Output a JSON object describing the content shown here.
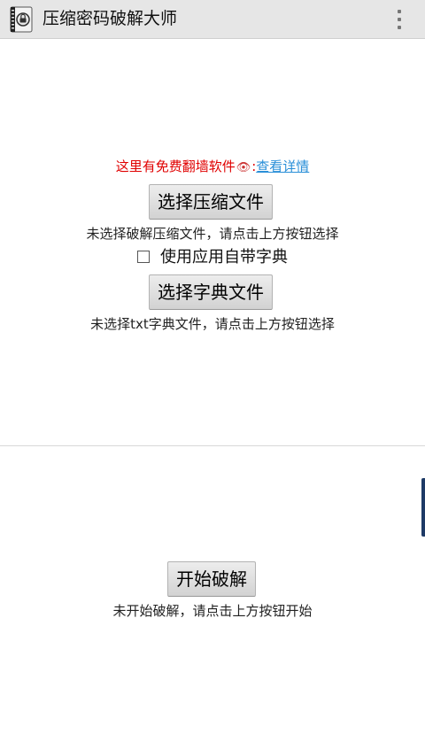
{
  "header": {
    "title": "压缩密码破解大师",
    "app_icon": "archive-app-icon",
    "menu_icon": "overflow-menu-icon"
  },
  "ad": {
    "text": "这里有免费翻墙软件",
    "eye": "👁",
    "separator": ":",
    "link_label": "查看详情"
  },
  "compress": {
    "button_label": "选择压缩文件",
    "status": "未选择破解压缩文件，请点击上方按钮选择"
  },
  "dict_option": {
    "label": "使用应用自带字典",
    "checked": false
  },
  "dictionary": {
    "button_label": "选择字典文件",
    "status": "未选择txt字典文件，请点击上方按钮选择"
  },
  "crack": {
    "button_label": "开始破解",
    "status": "未开始破解，请点击上方按钮开始"
  },
  "colors": {
    "ad_text": "#e00000",
    "link": "#2a8fd8",
    "action_bar": "#e6e6e6"
  }
}
